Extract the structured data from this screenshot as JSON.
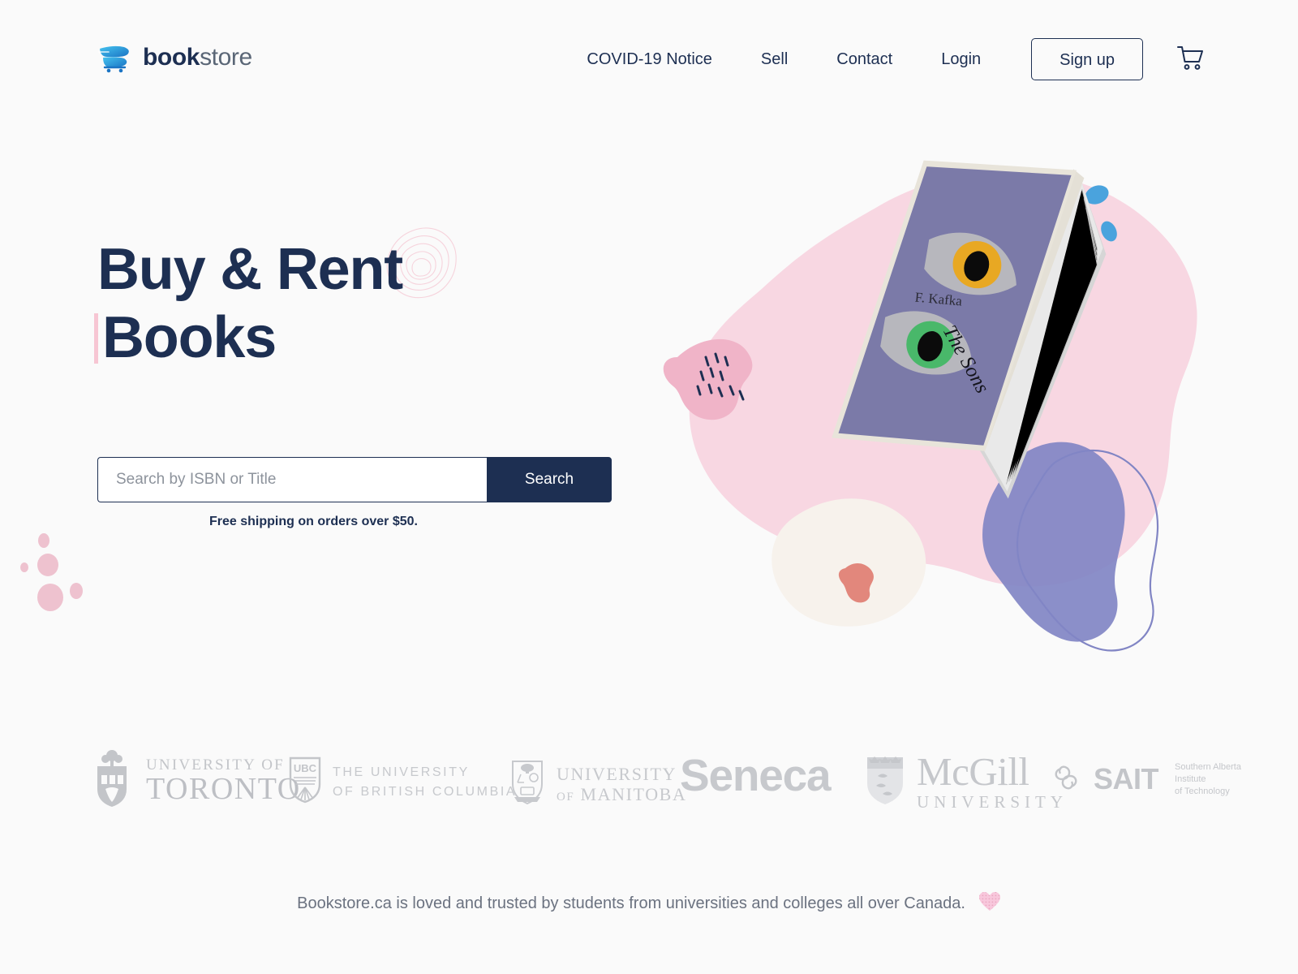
{
  "brand": {
    "logo_icon": "bookstore-swoosh-cart-icon",
    "name_bold": "book",
    "name_light": "store",
    "accent_blue": "#2196d8",
    "navy": "#1d2f52",
    "pink": "#f7c6d3"
  },
  "nav": {
    "links": [
      {
        "label": "COVID-19 Notice"
      },
      {
        "label": "Sell"
      },
      {
        "label": "Contact"
      },
      {
        "label": "Login"
      }
    ],
    "signup_label": "Sign up",
    "cart_icon": "shopping-cart-icon"
  },
  "hero": {
    "heading_line1": "Buy & Rent",
    "heading_line2": "Books",
    "decor_contour": "topographic-contour-decoration",
    "search": {
      "placeholder": "Search by ISBN or Title",
      "value": "",
      "button_label": "Search"
    },
    "shipping_note": "Free shipping on orders over $50."
  },
  "artwork": {
    "book": {
      "author": "F. Kafka",
      "title": "The Sons",
      "cover_color": "#7b7aa8",
      "iris_top_color": "#e8a823",
      "iris_bottom_color": "#49b86a",
      "sclera_color": "#b7b7bd"
    },
    "blobs": [
      {
        "name": "big-pink-blob",
        "color": "#f8d7e2"
      },
      {
        "name": "dark-pink-blob",
        "color": "#f0b4c8"
      },
      {
        "name": "cream-blob",
        "color": "#f7f2ec"
      },
      {
        "name": "coral-blob",
        "color": "#e2877c"
      },
      {
        "name": "periwinkle-blob",
        "color": "#8185c4"
      },
      {
        "name": "periwinkle-outline-blob",
        "color": "#8185c4"
      }
    ],
    "droplets_color": "#4aa3dd",
    "pebbles_color": "#eec2cf"
  },
  "universities": [
    {
      "id": "toronto",
      "crest": "toronto-crest-icon",
      "line1": "UNIVERSITY OF",
      "line2": "TORONTO"
    },
    {
      "id": "ubc",
      "crest": "ubc-shield-icon",
      "line1": "THE UNIVERSITY",
      "line2": "OF BRITISH COLUMBIA"
    },
    {
      "id": "manitoba",
      "crest": "manitoba-crest-icon",
      "line1": "UNIVERSITY",
      "line2_small": "OF",
      "line2": "MANITOBA"
    },
    {
      "id": "seneca",
      "wordmark": "Seneca"
    },
    {
      "id": "mcgill",
      "crest": "mcgill-shield-icon",
      "line1": "McGill",
      "line2": "UNIVERSITY"
    },
    {
      "id": "sait",
      "crest": "sait-knot-icon",
      "wordmark": "SAIT",
      "sub1": "Southern Alberta",
      "sub2": "Institute",
      "sub3": "of Technology"
    }
  ],
  "footer": {
    "tagline": "Bookstore.ca is loved and trusted by students from universities and colleges all over Canada.",
    "heart_icon": "pink-heart-icon"
  }
}
